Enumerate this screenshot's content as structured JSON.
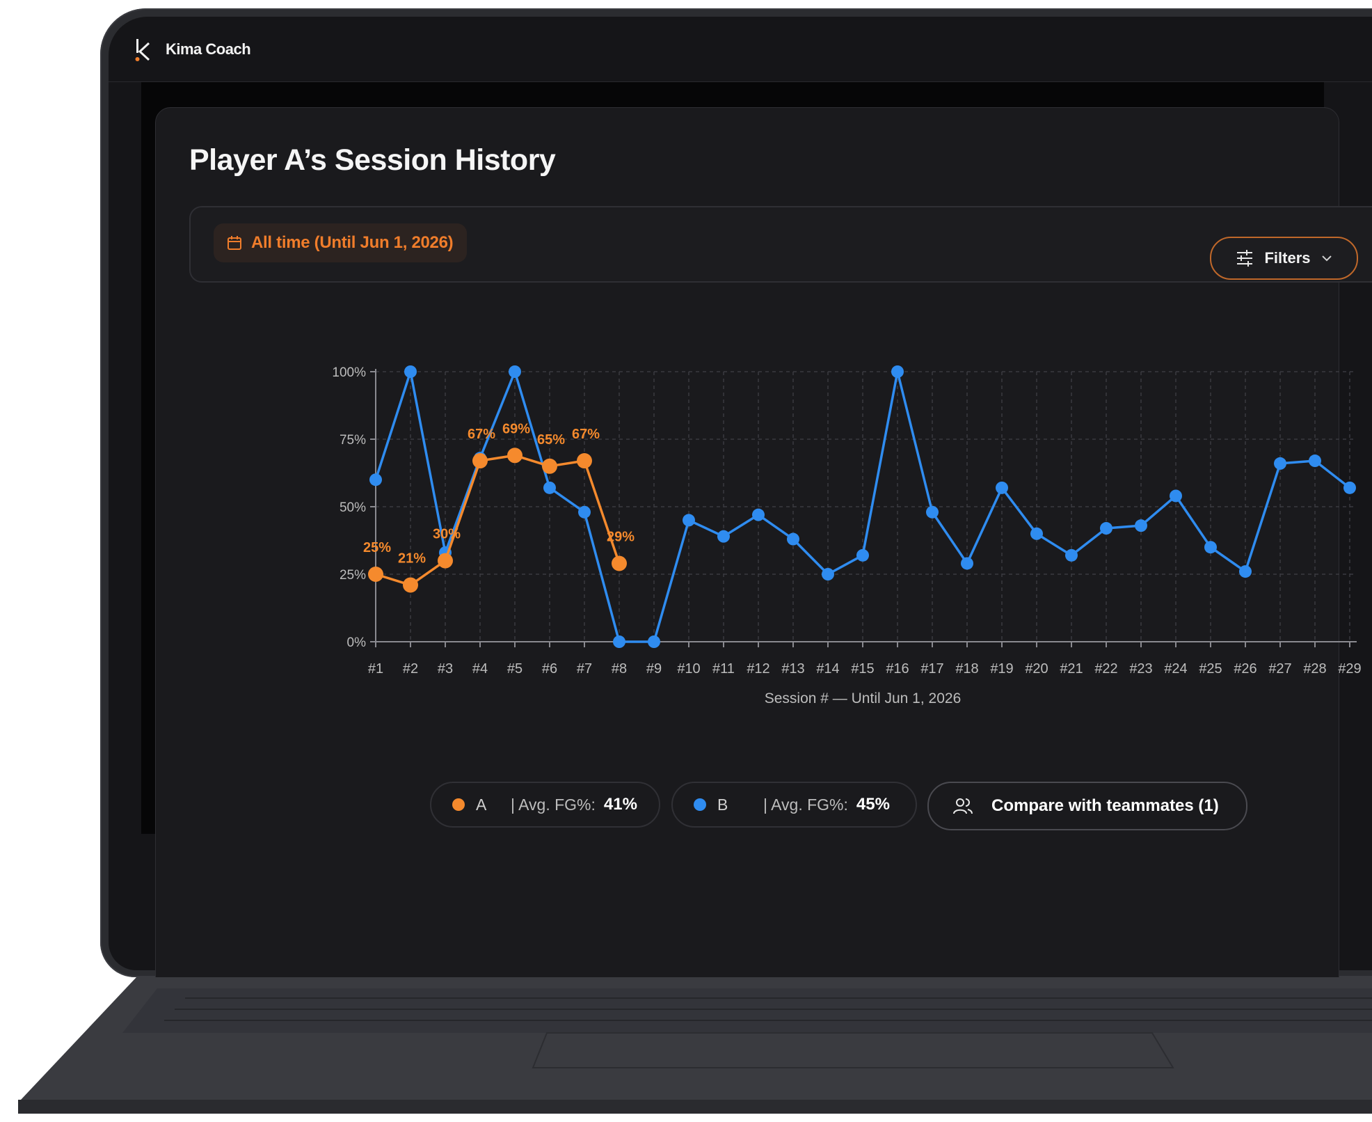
{
  "app": {
    "brand": "Kima Coach"
  },
  "page": {
    "title": "Player A’s Session History"
  },
  "filter_bar": {
    "date_range_label": "All time (Until Jun 1, 2026)",
    "filters_label": "Filters"
  },
  "legend": {
    "series_a": {
      "name": "A",
      "stat_label": "| Avg. FG%:",
      "stat_value": "41%",
      "color": "#f58a2d"
    },
    "series_b": {
      "name": "B",
      "stat_label": "| Avg. FG%:",
      "stat_value": "45%",
      "color": "#2f8cf0"
    },
    "compare_label": "Compare with teammates (1)"
  },
  "chart_data": {
    "type": "line",
    "xlabel": "Session # — Until Jun 1, 2026",
    "ylabel": "",
    "ylim": [
      0,
      100
    ],
    "yticks": [
      "0%",
      "25%",
      "50%",
      "75%",
      "100%"
    ],
    "categories": [
      "#1",
      "#2",
      "#3",
      "#4",
      "#5",
      "#6",
      "#7",
      "#8",
      "#9",
      "#10",
      "#11",
      "#12",
      "#13",
      "#14",
      "#15",
      "#16",
      "#17",
      "#18",
      "#19",
      "#20",
      "#21",
      "#22",
      "#23",
      "#24",
      "#25",
      "#26",
      "#27",
      "#28",
      "#29"
    ],
    "grid": true,
    "series": [
      {
        "name": "B",
        "color": "#2f8cf0",
        "values": [
          60,
          100,
          33,
          68,
          100,
          57,
          48,
          0,
          0,
          45,
          39,
          47,
          38,
          25,
          32,
          100,
          48,
          29,
          57,
          40,
          32,
          42,
          43,
          54,
          35,
          26,
          66,
          67,
          57
        ]
      },
      {
        "name": "A",
        "color": "#f58a2d",
        "values": [
          25,
          21,
          30,
          67,
          69,
          65,
          67,
          29
        ],
        "labels": [
          "25%",
          "21%",
          "30%",
          "67%",
          "69%",
          "65%",
          "67%",
          "29%"
        ]
      }
    ]
  }
}
